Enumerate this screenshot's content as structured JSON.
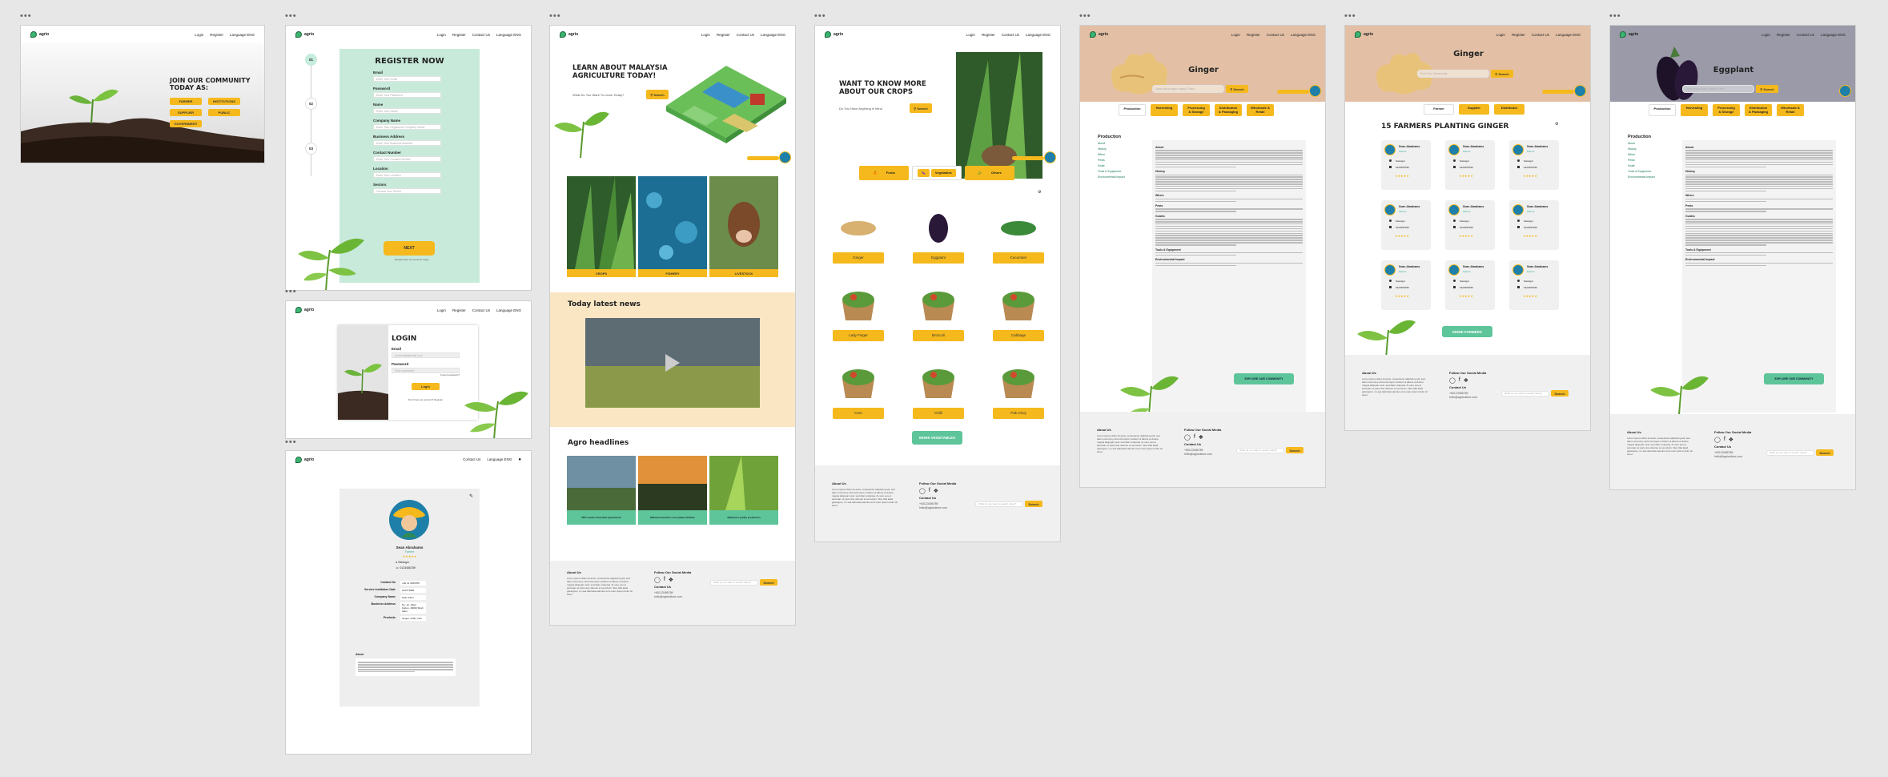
{
  "common": {
    "brand": "agrio",
    "nav_login": "Login",
    "nav_register": "Register",
    "nav_contact": "Contact Us",
    "nav_language": "Language ENG",
    "search_label": "Search",
    "footer_about_title": "About Us",
    "footer_about_text": "Lorem ipsum dolor sit amet, consectetur adipiscing elit, sed diam nonummy eirmod tempor invidunt ut labore et dolore magna aliquyam erat, sed diam voluptua. At vero eos et accusam et justo duo dolores et ea rebum. Stet clita kasd gubergren, no sea takimata sanctus est Lorem ipsum dolor sit amet.",
    "footer_follow": "Follow Our Social Media",
    "footer_contact": "Contact Us",
    "footer_phone": "+60123456789",
    "footer_email": "hello@agriculture.com",
    "footer_search_placeholder": "What do you want to search today?",
    "explore_btn": "EXPLORE OUR COMMUNITY"
  },
  "join": {
    "title": "JOIN OUR COMMUNITY TODAY AS:",
    "roles": [
      "FARMER",
      "INSTITUTIONS",
      "SUPPLIER",
      "PUBLIC",
      "GOVERNMENT"
    ]
  },
  "register": {
    "steps": [
      "01",
      "02",
      "03"
    ],
    "title": "REGISTER NOW",
    "fields": [
      {
        "label": "Email",
        "placeholder": "Enter Your Email"
      },
      {
        "label": "Password",
        "placeholder": "Enter Your Password"
      },
      {
        "label": "Name",
        "placeholder": "Enter Your Name"
      },
      {
        "label": "Company Name",
        "placeholder": "Enter Your Registered Company Name"
      },
      {
        "label": "Business Address",
        "placeholder": "Enter Your Business Address"
      },
      {
        "label": "Contact Number",
        "placeholder": "Enter Your Contact Number"
      },
      {
        "label": "Location",
        "placeholder": "Enter Your Location"
      },
      {
        "label": "Sectors",
        "placeholder": "Choose Your Sector"
      }
    ],
    "next": "NEXT",
    "already": "Already have an account? Login"
  },
  "login": {
    "title": "LOGIN",
    "email_label": "Email",
    "email_placeholder": "youremail@email.com",
    "password_label": "Password",
    "password_placeholder": "Enter password",
    "forgot": "Forgot password?",
    "button": "Login",
    "signup": "Don't have an account? Register"
  },
  "profile": {
    "name": "Sean Abrahams",
    "role": "Farmer",
    "location": "Selangor",
    "phone": "0123456789",
    "rows": [
      {
        "k": "Contact No",
        "v": "+60 12 3456789"
      },
      {
        "k": "Service Institution Date",
        "v": "01/07/1998"
      },
      {
        "k": "Company Name",
        "v": "Sean Farm"
      },
      {
        "k": "Business Address",
        "v": "No. 12, Jalan Kebun, 40000 Shah Alam"
      },
      {
        "k": "Products",
        "v": "Ginger, Chilli, Corn"
      }
    ],
    "about_title": "About"
  },
  "learn": {
    "title": "LEARN ABOUT MALAYSIA AGRICULTURE TODAY!",
    "search_placeholder": "What Do You Want To Learn Today?",
    "categories": [
      "CROPS",
      "FISHERY",
      "LIVESTOCK"
    ],
    "news_title": "Today latest news",
    "headlines_title": "Agro headlines",
    "headlines": [
      "MPI-Leaders Potential Agricultural",
      "Malaysia launches new paddy initiative",
      "Malaysia's paddy production"
    ]
  },
  "crops": {
    "title": "WANT TO KNOW MORE ABOUT OUR CROPS",
    "search_placeholder": "Do You Have Anything in Mind",
    "tabs": [
      "Fruits",
      "Vegetables",
      "Others"
    ],
    "items": [
      "Ginger",
      "Eggplant",
      "Cucumber",
      "Lady Finger",
      "Broccoli",
      "Cabbage",
      "Corn",
      "Chilli",
      "Pak Choy"
    ],
    "more_btn": "MORE VEGETABLES"
  },
  "ginger": {
    "title": "Ginger",
    "search_placeholder": "Learn About Agro Supply Chain",
    "tabs": [
      "Production",
      "Harvesting",
      "Processing & Storage",
      "Distribution & Packaging",
      "Wholesale & Retail"
    ],
    "side_title": "Production",
    "side_items": [
      "About",
      "History",
      "When",
      "Pests",
      "Scale",
      "Tools & Equipment",
      "Environmental Impact"
    ],
    "sections": [
      "About",
      "History",
      "Where",
      "Pests",
      "Guides",
      "Tools & Equipment",
      "Environmental Impact"
    ]
  },
  "farmers": {
    "title": "Ginger",
    "search_placeholder": "Find Your Community",
    "tabs": [
      "Farmer",
      "Supplier",
      "Distributor"
    ],
    "heading": "15 FARMERS PLANTING GINGER",
    "card_name": "Sean Abrahams",
    "card_role": "Farmer",
    "card_loc": "Selangor",
    "card_phone": "0123456789",
    "more_btn": "MORE FARMERS"
  },
  "eggplant": {
    "title": "Eggplant",
    "search_placeholder": "Learn About Agro Supply Chain",
    "tabs": [
      "Production",
      "Harvesting",
      "Processing & Storage",
      "Distribution & Packaging",
      "Wholesale & Retail"
    ],
    "side_title": "Production"
  }
}
